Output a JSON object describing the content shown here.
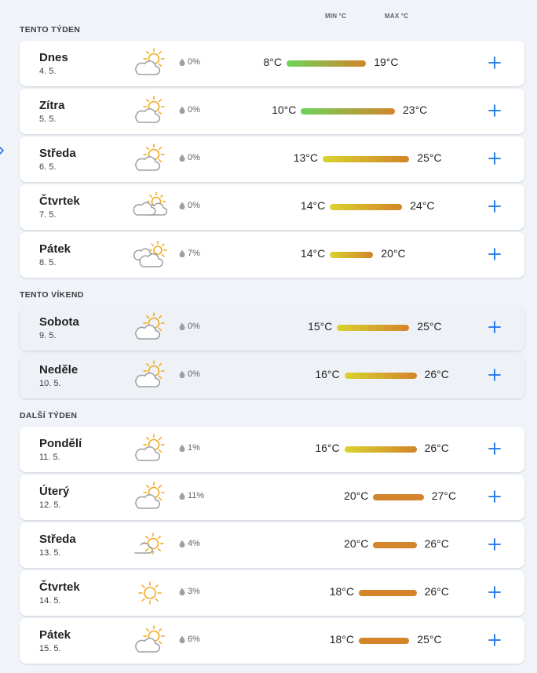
{
  "headers": {
    "min_label": "MIN °C",
    "max_label": "MAX °C"
  },
  "sections": [
    {
      "title": "TENTO TÝDEN",
      "weekend": false,
      "days": [
        {
          "name": "Dnes",
          "date": "4. 5.",
          "icon": "partly-cloudy-sun-icon",
          "precip": "0%",
          "min": "8°C",
          "max": "19°C",
          "min_v": 8,
          "max_v": 19
        },
        {
          "name": "Zítra",
          "date": "5. 5.",
          "icon": "partly-cloudy-sun-icon",
          "precip": "0%",
          "min": "10°C",
          "max": "23°C",
          "min_v": 10,
          "max_v": 23
        },
        {
          "name": "Středa",
          "date": "6. 5.",
          "icon": "partly-cloudy-sun-icon",
          "precip": "0%",
          "min": "13°C",
          "max": "25°C",
          "min_v": 13,
          "max_v": 25
        },
        {
          "name": "Čtvrtek",
          "date": "7. 5.",
          "icon": "cloudy-sun-icon",
          "precip": "0%",
          "min": "14°C",
          "max": "24°C",
          "min_v": 14,
          "max_v": 24
        },
        {
          "name": "Pátek",
          "date": "8. 5.",
          "icon": "mostly-cloudy-icon",
          "precip": "7%",
          "min": "14°C",
          "max": "20°C",
          "min_v": 14,
          "max_v": 20
        }
      ]
    },
    {
      "title": "TENTO VÍKEND",
      "weekend": true,
      "days": [
        {
          "name": "Sobota",
          "date": "9. 5.",
          "icon": "partly-cloudy-sun-icon",
          "precip": "0%",
          "min": "15°C",
          "max": "25°C",
          "min_v": 15,
          "max_v": 25
        },
        {
          "name": "Neděle",
          "date": "10. 5.",
          "icon": "partly-cloudy-sun-icon",
          "precip": "0%",
          "min": "16°C",
          "max": "26°C",
          "min_v": 16,
          "max_v": 26
        }
      ]
    },
    {
      "title": "DALŠÍ TÝDEN",
      "weekend": false,
      "days": [
        {
          "name": "Pondělí",
          "date": "11. 5.",
          "icon": "partly-cloudy-sun-icon",
          "precip": "1%",
          "min": "16°C",
          "max": "26°C",
          "min_v": 16,
          "max_v": 26
        },
        {
          "name": "Úterý",
          "date": "12. 5.",
          "icon": "partly-cloudy-sun-icon",
          "precip": "11%",
          "min": "20°C",
          "max": "27°C",
          "min_v": 20,
          "max_v": 27
        },
        {
          "name": "Středa",
          "date": "13. 5.",
          "icon": "mostly-sunny-icon",
          "precip": "4%",
          "min": "20°C",
          "max": "26°C",
          "min_v": 20,
          "max_v": 26
        },
        {
          "name": "Čtvrtek",
          "date": "14. 5.",
          "icon": "sun-icon",
          "precip": "3%",
          "min": "18°C",
          "max": "26°C",
          "min_v": 18,
          "max_v": 26
        },
        {
          "name": "Pátek",
          "date": "15. 5.",
          "icon": "partly-cloudy-sun-icon",
          "precip": "6%",
          "min": "18°C",
          "max": "25°C",
          "min_v": 18,
          "max_v": 25
        }
      ]
    }
  ],
  "colors": {
    "accent": "#1a73e8",
    "cool": "#6cd35a",
    "mild": "#d8d32f",
    "warm": "#d4842a",
    "sun": "#f2a81d",
    "cloud": "#9aa0a6"
  }
}
